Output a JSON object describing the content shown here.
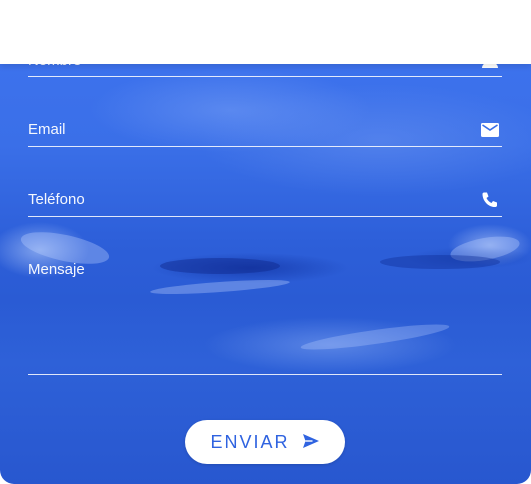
{
  "form": {
    "fields": [
      {
        "label": "Nombre",
        "icon": "person-icon"
      },
      {
        "label": "Email",
        "icon": "mail-icon"
      },
      {
        "label": "Teléfono",
        "icon": "phone-icon"
      },
      {
        "label": "Mensaje",
        "icon": ""
      }
    ],
    "submit_label": "ENVIAR",
    "submit_icon": "send-icon"
  },
  "colors": {
    "accent": "#2f63e0",
    "background_tint": "#3a6fe8",
    "field_text": "#ffffff"
  }
}
